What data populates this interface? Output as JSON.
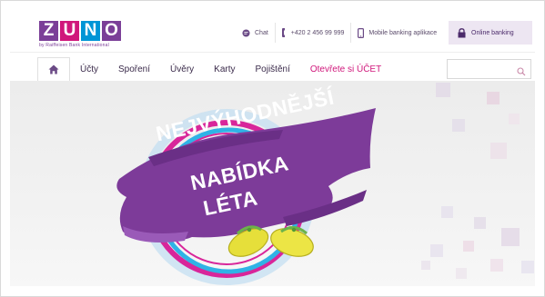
{
  "brand": {
    "letters": [
      "Z",
      "U",
      "N",
      "O"
    ],
    "letter_colors": [
      "#7b3f98",
      "#d0177b",
      "#0095d6",
      "#7b3f98"
    ],
    "tagline": "by Raiffeisen Bank International"
  },
  "topbar": {
    "chat_label": "Chat",
    "phone_label": "+420 2 456 99 999",
    "mobile_label": "Mobile banking aplikace",
    "online_label": "Online banking"
  },
  "nav": {
    "home_icon": "home-icon",
    "items": [
      "Účty",
      "Spoření",
      "Úvěry",
      "Karty",
      "Pojištění"
    ],
    "highlight_item": "Otevřete si ÚČET",
    "search_placeholder": ""
  },
  "hero": {
    "headline_lines": [
      "NEJVÝHODNĚJŠÍ",
      "NABÍDKA",
      "LÉTA"
    ],
    "image": "flip-flops"
  },
  "colors": {
    "purple": "#7b3f98",
    "pink": "#d0177b",
    "blue": "#0095d6",
    "online_bg": "#ede6f2"
  }
}
